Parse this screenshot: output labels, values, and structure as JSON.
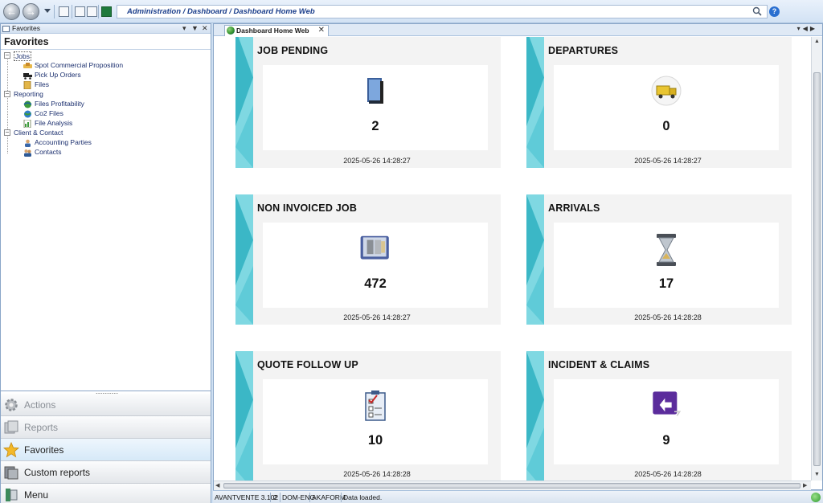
{
  "toolbar": {
    "address": "Administration / Dashboard / Dashboard Home Web"
  },
  "left_panel": {
    "header_label": "Favorites",
    "title": "Favorites",
    "tree": [
      {
        "label": "Jobs",
        "items": [
          "Spot Commercial Proposition",
          "Pick Up Orders",
          "Files"
        ]
      },
      {
        "label": "Reporting",
        "items": [
          "Files Profitability",
          "Co2 Files",
          "File Analysis"
        ]
      },
      {
        "label": "Client & Contact",
        "items": [
          "Accounting Parties",
          "Contacts"
        ]
      }
    ],
    "sections": [
      "Actions",
      "Reports",
      "Favorites",
      "Custom reports",
      "Menu"
    ]
  },
  "tab": {
    "label": "Dashboard Home Web"
  },
  "cards": [
    {
      "title": "JOB PENDING",
      "count": "2",
      "time": "2025-05-26 14:28:27",
      "icon": "book-icon"
    },
    {
      "title": "DEPARTURES",
      "count": "0",
      "time": "2025-05-26 14:28:27",
      "icon": "truck-icon"
    },
    {
      "title": "NON INVOICED JOB",
      "count": "472",
      "time": "2025-05-26 14:28:27",
      "icon": "documents-icon"
    },
    {
      "title": "ARRIVALS",
      "count": "17",
      "time": "2025-05-26 14:28:28",
      "icon": "hourglass-icon"
    },
    {
      "title": "QUOTE FOLLOW UP",
      "count": "10",
      "time": "2025-05-26 14:28:28",
      "icon": "checklist-icon"
    },
    {
      "title": "INCIDENT & CLAIMS",
      "count": "9",
      "time": "2025-05-26 14:28:28",
      "icon": "return-arrow-icon"
    }
  ],
  "status": {
    "app": "AVANTVENTE 3.102",
    "code": "2",
    "lang": "DOM-ENG",
    "form": "AKAFORM",
    "message": "Data loaded."
  },
  "colors": {
    "stripe_dark": "#3bb7c6",
    "stripe_light": "#7fd8e2",
    "card_bg": "#f3f3f3"
  }
}
